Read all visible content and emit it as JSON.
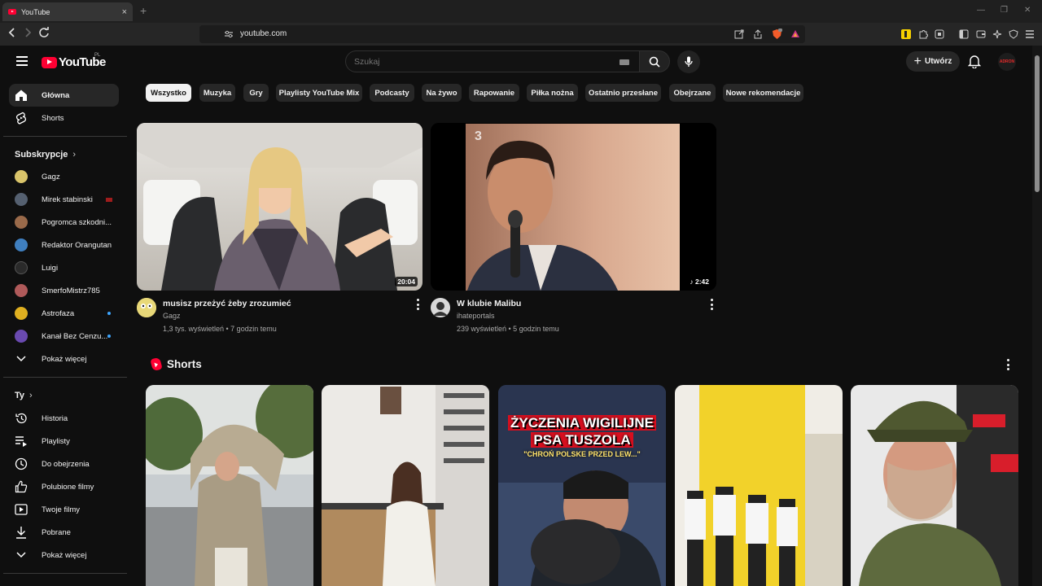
{
  "browser": {
    "tab_title": "YouTube",
    "tab_close": "×",
    "new_tab": "+",
    "url": "youtube.com"
  },
  "header": {
    "logo_text": "YouTube",
    "country_code": "PL",
    "search_placeholder": "Szukaj",
    "create_label": "Utwórz",
    "avatar_text": "ADRON"
  },
  "sidebar": {
    "main": [
      {
        "label": "Główna",
        "icon": "home-icon"
      },
      {
        "label": "Shorts",
        "icon": "shorts-icon"
      }
    ],
    "subscriptions_heading": "Subskrypcje",
    "subscriptions": [
      {
        "label": "Gagz",
        "color": "#d9c46a",
        "indicator": "none"
      },
      {
        "label": "Mirek stabinski",
        "color": "#556070",
        "indicator": "live"
      },
      {
        "label": "Pogromca szkodni...",
        "color": "#9a6a4a",
        "indicator": "none"
      },
      {
        "label": "Redaktor Orangutan",
        "color": "#3f7fbf",
        "indicator": "none"
      },
      {
        "label": "Luigi",
        "color": "#2a2a2a",
        "indicator": "none"
      },
      {
        "label": "SmerfoMistrz785",
        "color": "#b05a5a",
        "indicator": "none"
      },
      {
        "label": "Astrofaza",
        "color": "#e0b020",
        "indicator": "new"
      },
      {
        "label": "Kanał Bez Cenzu...",
        "color": "#6a4ab0",
        "indicator": "new"
      }
    ],
    "show_more_1": "Pokaż więcej",
    "you_heading": "Ty",
    "you_items": [
      {
        "label": "Historia",
        "icon": "history-icon"
      },
      {
        "label": "Playlisty",
        "icon": "playlists-icon"
      },
      {
        "label": "Do obejrzenia",
        "icon": "watch-later-icon"
      },
      {
        "label": "Polubione filmy",
        "icon": "thumbs-up-icon"
      },
      {
        "label": "Twoje filmy",
        "icon": "your-videos-icon"
      },
      {
        "label": "Pobrane",
        "icon": "download-icon"
      }
    ],
    "show_more_2": "Pokaż więcej"
  },
  "chips": [
    "Wszystko",
    "Muzyka",
    "Gry",
    "Playlisty YouTube Mix",
    "Podcasty",
    "Na żywo",
    "Rapowanie",
    "Piłka nożna",
    "Ostatnio przesłane",
    "Obejrzane",
    "Nowe rekomendacje"
  ],
  "videos": [
    {
      "title": "musisz przeżyć żeby zrozumieć",
      "channel": "Gagz",
      "meta": "1,3 tys. wyświetleń • 7 godzin temu",
      "duration": "20:04"
    },
    {
      "title": "W klubie Malibu",
      "channel": "ihateportals",
      "meta": "239 wyświetleń • 5 godzin temu",
      "duration": "♪ 2:42",
      "watermark": "3"
    }
  ],
  "shorts": {
    "heading": "Shorts",
    "items": [
      {
        "caption_line1": "",
        "caption_line2": "",
        "caption_sub": ""
      },
      {
        "caption_line1": "",
        "caption_line2": "",
        "caption_sub": ""
      },
      {
        "caption_line1": "ŻYCZENIA WIGILIJNE",
        "caption_line2": "PSA TUSZOLA",
        "caption_sub": "\"CHROŃ POLSKE PRZED LEW...\""
      },
      {
        "caption_line1": "",
        "caption_line2": "",
        "caption_sub": ""
      },
      {
        "caption_line1": "",
        "caption_line2": "",
        "caption_sub": ""
      }
    ]
  },
  "colors": {
    "accent_red": "#ff0033",
    "background": "#0f0f0f",
    "chip_bg": "#272727"
  }
}
